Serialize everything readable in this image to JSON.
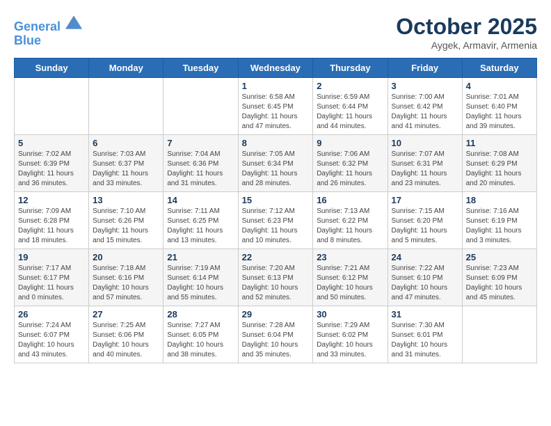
{
  "header": {
    "logo_line1": "General",
    "logo_line2": "Blue",
    "month_title": "October 2025",
    "subtitle": "Aygek, Armavir, Armenia"
  },
  "days_of_week": [
    "Sunday",
    "Monday",
    "Tuesday",
    "Wednesday",
    "Thursday",
    "Friday",
    "Saturday"
  ],
  "weeks": [
    [
      {
        "day": "",
        "info": ""
      },
      {
        "day": "",
        "info": ""
      },
      {
        "day": "",
        "info": ""
      },
      {
        "day": "1",
        "info": "Sunrise: 6:58 AM\nSunset: 6:45 PM\nDaylight: 11 hours and 47 minutes."
      },
      {
        "day": "2",
        "info": "Sunrise: 6:59 AM\nSunset: 6:44 PM\nDaylight: 11 hours and 44 minutes."
      },
      {
        "day": "3",
        "info": "Sunrise: 7:00 AM\nSunset: 6:42 PM\nDaylight: 11 hours and 41 minutes."
      },
      {
        "day": "4",
        "info": "Sunrise: 7:01 AM\nSunset: 6:40 PM\nDaylight: 11 hours and 39 minutes."
      }
    ],
    [
      {
        "day": "5",
        "info": "Sunrise: 7:02 AM\nSunset: 6:39 PM\nDaylight: 11 hours and 36 minutes."
      },
      {
        "day": "6",
        "info": "Sunrise: 7:03 AM\nSunset: 6:37 PM\nDaylight: 11 hours and 33 minutes."
      },
      {
        "day": "7",
        "info": "Sunrise: 7:04 AM\nSunset: 6:36 PM\nDaylight: 11 hours and 31 minutes."
      },
      {
        "day": "8",
        "info": "Sunrise: 7:05 AM\nSunset: 6:34 PM\nDaylight: 11 hours and 28 minutes."
      },
      {
        "day": "9",
        "info": "Sunrise: 7:06 AM\nSunset: 6:32 PM\nDaylight: 11 hours and 26 minutes."
      },
      {
        "day": "10",
        "info": "Sunrise: 7:07 AM\nSunset: 6:31 PM\nDaylight: 11 hours and 23 minutes."
      },
      {
        "day": "11",
        "info": "Sunrise: 7:08 AM\nSunset: 6:29 PM\nDaylight: 11 hours and 20 minutes."
      }
    ],
    [
      {
        "day": "12",
        "info": "Sunrise: 7:09 AM\nSunset: 6:28 PM\nDaylight: 11 hours and 18 minutes."
      },
      {
        "day": "13",
        "info": "Sunrise: 7:10 AM\nSunset: 6:26 PM\nDaylight: 11 hours and 15 minutes."
      },
      {
        "day": "14",
        "info": "Sunrise: 7:11 AM\nSunset: 6:25 PM\nDaylight: 11 hours and 13 minutes."
      },
      {
        "day": "15",
        "info": "Sunrise: 7:12 AM\nSunset: 6:23 PM\nDaylight: 11 hours and 10 minutes."
      },
      {
        "day": "16",
        "info": "Sunrise: 7:13 AM\nSunset: 6:22 PM\nDaylight: 11 hours and 8 minutes."
      },
      {
        "day": "17",
        "info": "Sunrise: 7:15 AM\nSunset: 6:20 PM\nDaylight: 11 hours and 5 minutes."
      },
      {
        "day": "18",
        "info": "Sunrise: 7:16 AM\nSunset: 6:19 PM\nDaylight: 11 hours and 3 minutes."
      }
    ],
    [
      {
        "day": "19",
        "info": "Sunrise: 7:17 AM\nSunset: 6:17 PM\nDaylight: 11 hours and 0 minutes."
      },
      {
        "day": "20",
        "info": "Sunrise: 7:18 AM\nSunset: 6:16 PM\nDaylight: 10 hours and 57 minutes."
      },
      {
        "day": "21",
        "info": "Sunrise: 7:19 AM\nSunset: 6:14 PM\nDaylight: 10 hours and 55 minutes."
      },
      {
        "day": "22",
        "info": "Sunrise: 7:20 AM\nSunset: 6:13 PM\nDaylight: 10 hours and 52 minutes."
      },
      {
        "day": "23",
        "info": "Sunrise: 7:21 AM\nSunset: 6:12 PM\nDaylight: 10 hours and 50 minutes."
      },
      {
        "day": "24",
        "info": "Sunrise: 7:22 AM\nSunset: 6:10 PM\nDaylight: 10 hours and 47 minutes."
      },
      {
        "day": "25",
        "info": "Sunrise: 7:23 AM\nSunset: 6:09 PM\nDaylight: 10 hours and 45 minutes."
      }
    ],
    [
      {
        "day": "26",
        "info": "Sunrise: 7:24 AM\nSunset: 6:07 PM\nDaylight: 10 hours and 43 minutes."
      },
      {
        "day": "27",
        "info": "Sunrise: 7:25 AM\nSunset: 6:06 PM\nDaylight: 10 hours and 40 minutes."
      },
      {
        "day": "28",
        "info": "Sunrise: 7:27 AM\nSunset: 6:05 PM\nDaylight: 10 hours and 38 minutes."
      },
      {
        "day": "29",
        "info": "Sunrise: 7:28 AM\nSunset: 6:04 PM\nDaylight: 10 hours and 35 minutes."
      },
      {
        "day": "30",
        "info": "Sunrise: 7:29 AM\nSunset: 6:02 PM\nDaylight: 10 hours and 33 minutes."
      },
      {
        "day": "31",
        "info": "Sunrise: 7:30 AM\nSunset: 6:01 PM\nDaylight: 10 hours and 31 minutes."
      },
      {
        "day": "",
        "info": ""
      }
    ]
  ]
}
